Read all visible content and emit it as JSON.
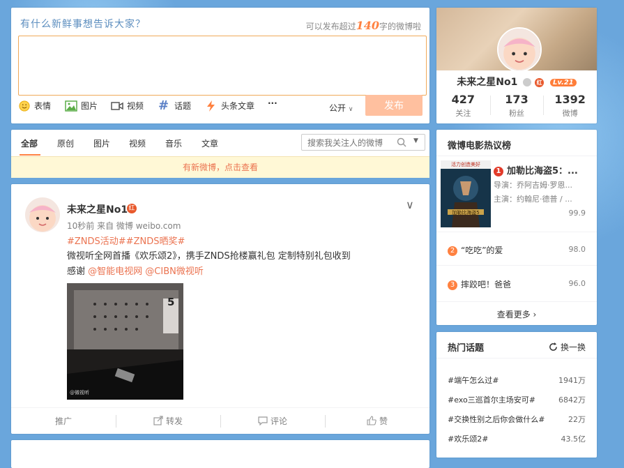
{
  "publisher": {
    "prompt": "有什么新鲜事想告诉大家？",
    "limit_prefix": "可以发布超过",
    "limit_number": "140",
    "limit_suffix": "字的微博啦",
    "tools": [
      "表情",
      "图片",
      "视频",
      "话题",
      "头条文章",
      "···"
    ],
    "visibility": "公开",
    "send": "发布"
  },
  "tabs": {
    "items": [
      "全部",
      "原创",
      "图片",
      "视频",
      "音乐",
      "文章"
    ],
    "search_placeholder": "搜索我关注人的微博",
    "new_notice": "有新微博，点击查看"
  },
  "post": {
    "author": "未来之星No1",
    "badge": "红",
    "meta": "10秒前 来自 微博 weibo.com",
    "topics": "#ZNDS活动##ZNDS晒奖#",
    "text_line1": "微视听全网首播《欢乐颂2》，携手ZNDS抢楼赢礼包   定制特别礼包收到",
    "text_prefix": "感谢 ",
    "mention1": "@智能电视网",
    "mention2": "@CIBN微视听",
    "photo_number": "5",
    "photo_watermark": "@微视听",
    "actions": [
      "推广",
      "转发",
      "评论",
      "赞"
    ]
  },
  "profile": {
    "name": "未来之星No1",
    "level": "Lv.21",
    "badge": "红",
    "stats": [
      {
        "num": "427",
        "label": "关注"
      },
      {
        "num": "173",
        "label": "粉丝"
      },
      {
        "num": "1392",
        "label": "微博"
      }
    ]
  },
  "movies": {
    "title": "微博电影热议榜",
    "poster_banner": "活力创造美好",
    "poster_title": "加勒比海盗5",
    "items": [
      {
        "rank": "1",
        "name": "加勒比海盗5：...",
        "line1": "导演：乔阿吉姆·罗恩...",
        "line2": "主演：约翰尼·德普 / ...",
        "score": "99.9"
      },
      {
        "rank": "2",
        "name": "“吃吃”的爱",
        "score": "98.0"
      },
      {
        "rank": "3",
        "name": "摔跤吧！爸爸",
        "score": "96.0"
      }
    ],
    "more": "查看更多 ›"
  },
  "hot_topics": {
    "title": "热门话题",
    "refresh": "换一换",
    "items": [
      {
        "name": "#端午怎么过#",
        "count": "1941万"
      },
      {
        "name": "#exo三巡首尔主场安可#",
        "count": "6842万"
      },
      {
        "name": "#交换性别之后你会做什么#",
        "count": "22万"
      },
      {
        "name": "#欢乐颂2#",
        "count": "43.5亿"
      }
    ]
  },
  "colors": {
    "accent": "#ff8140",
    "link": "#eb7350",
    "background": "#6aa6dc",
    "send_button": "#ffc09f"
  }
}
